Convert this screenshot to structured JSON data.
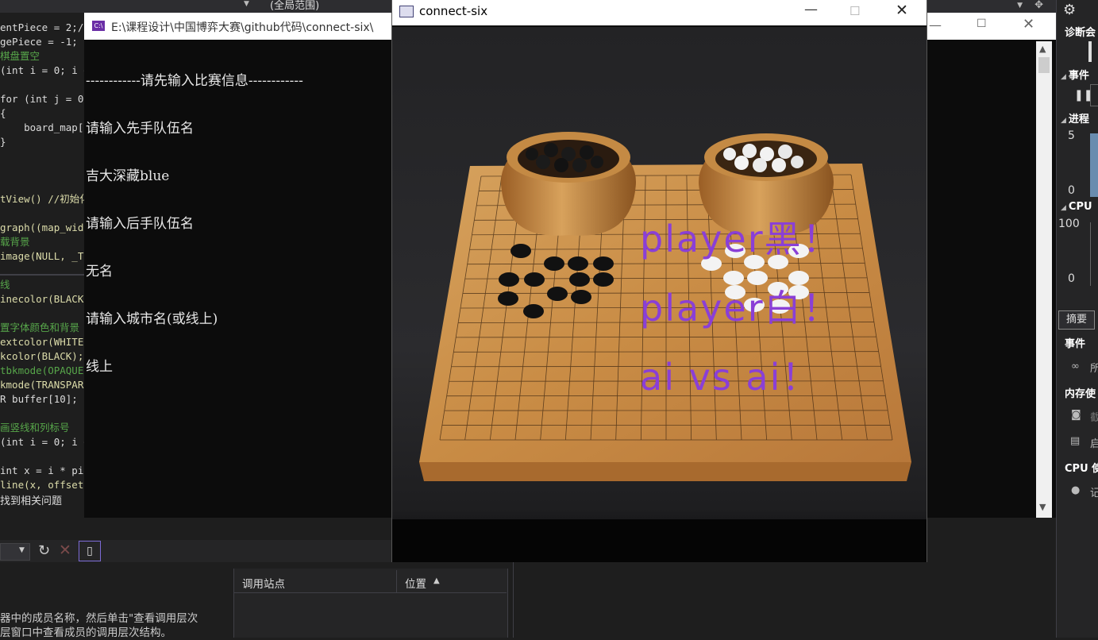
{
  "editor": {
    "scope_dropdown": "(全局范围)",
    "lines": [
      {
        "t": "entPiece = 2;//",
        "c": "def"
      },
      {
        "t": "gePiece = -1;",
        "c": "def"
      },
      {
        "t": "棋盘置空",
        "c": "cm"
      },
      {
        "t": "(int i = 0; i <",
        "c": "def"
      },
      {
        "t": "",
        "c": "def"
      },
      {
        "t": "for (int j = 0;",
        "c": "def"
      },
      {
        "t": "{",
        "c": "def"
      },
      {
        "t": "    board_map[i",
        "c": "def"
      },
      {
        "t": "}",
        "c": "def"
      },
      {
        "t": "",
        "c": "def"
      },
      {
        "t": "",
        "c": "def"
      },
      {
        "t": "",
        "c": "def"
      },
      {
        "t": "tView() //初始化",
        "c": "fn"
      },
      {
        "t": "",
        "c": "def"
      },
      {
        "t": "graph((map_widt",
        "c": "fn"
      },
      {
        "t": "载背景",
        "c": "cm"
      },
      {
        "t": "image(NULL, _T(",
        "c": "fn"
      },
      {
        "t": "",
        "c": "def"
      },
      {
        "t": "线",
        "c": "cm"
      },
      {
        "t": "inecolor(BLACK)",
        "c": "fn"
      },
      {
        "t": "",
        "c": "def"
      },
      {
        "t": "置字体颜色和背景",
        "c": "cm"
      },
      {
        "t": "extcolor(WHITE)",
        "c": "fn"
      },
      {
        "t": "kcolor(BLACK);",
        "c": "fn"
      },
      {
        "t": "tbkmode(OPAQUE)",
        "c": "cm"
      },
      {
        "t": "kmode(TRANSPARE",
        "c": "fn"
      },
      {
        "t": "R buffer[10]; /",
        "c": "def"
      },
      {
        "t": "",
        "c": "def"
      },
      {
        "t": "画竖线和列标号",
        "c": "cm"
      },
      {
        "t": "(int i = 0; i <",
        "c": "def"
      },
      {
        "t": "",
        "c": "def"
      },
      {
        "t": "int x = i * pie",
        "c": "def"
      },
      {
        "t": "line(x, offsety",
        "c": "fn"
      }
    ],
    "status": "找到相关问题"
  },
  "console": {
    "title": "E:\\课程设计\\中国博弈大赛\\github代码\\connect-six\\",
    "icon": "C:\\",
    "lines": [
      "------------请先输入比赛信息------------",
      "请输入先手队伍名",
      "吉大深藏blue",
      "请输入后手队伍名",
      "无名",
      "请输入城市名(或线上)",
      "线上"
    ]
  },
  "game": {
    "title": "connect-six",
    "overlay": [
      "player黑！",
      "player白！",
      "ai vs ai！"
    ],
    "overlay_color": "#8a3fd6"
  },
  "diagnostics": {
    "title": "诊断会",
    "events": "事件",
    "process": "进程",
    "proc_max": "5",
    "proc_min": "0",
    "cpu": "CPU",
    "cpu_max": "100",
    "cpu_min": "0",
    "summary": "摘要",
    "events2": "事件",
    "all": "所",
    "memory": "内存使",
    "snapshot": "截",
    "enable": "启",
    "cpu_use": "CPU 使",
    "record": "记"
  },
  "bottom": {
    "help": "器中的成员名称，然后单击\"查看调用层次\n层窗口中查看成员的调用层次结构。",
    "col_callsite": "调用站点",
    "col_location": "位置"
  }
}
